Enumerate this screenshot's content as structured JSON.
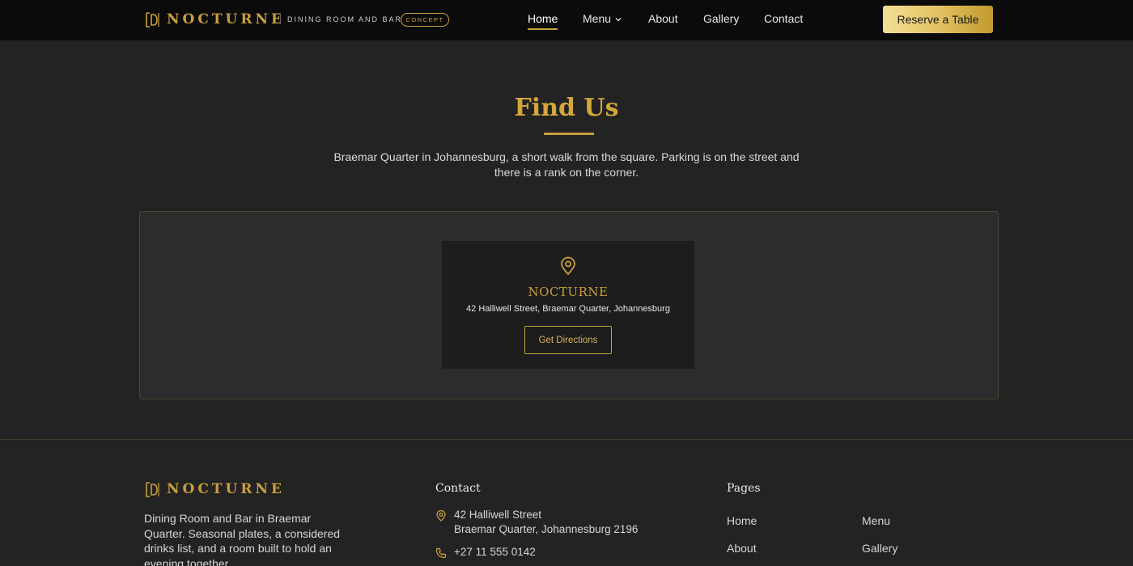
{
  "header": {
    "logo_text": "NOCTURNE",
    "tagline": "DINING ROOM AND BAR",
    "badge": "CONCEPT",
    "nav": {
      "home": "Home",
      "menu": "Menu",
      "about": "About",
      "gallery": "Gallery",
      "contact": "Contact"
    },
    "cta": "Reserve a Table"
  },
  "find_us": {
    "title": "Find Us",
    "description": "Braemar Quarter in Johannesburg, a short walk from the square. Parking is on the street and there is a rank on the corner.",
    "card": {
      "name": "NOCTURNE",
      "address": "42 Halliwell Street, Braemar Quarter, Johannesburg",
      "button": "Get Directions"
    }
  },
  "footer": {
    "logo_text": "NOCTURNE",
    "about": "Dining Room and Bar in Braemar Quarter. Seasonal plates, a considered drinks list, and a room built to hold an evening together.",
    "contact": {
      "heading": "Contact",
      "address_line1": "42 Halliwell Street",
      "address_line2": "Braemar Quarter, Johannesburg 2196",
      "phone": "+27 11 555 0142"
    },
    "pages": {
      "heading": "Pages",
      "home": "Home",
      "menu": "Menu",
      "about": "About",
      "gallery": "Gallery"
    }
  },
  "icons": {
    "logo": "logo-mark-icon",
    "nav_dropdown": "chevron-down-icon",
    "location": "map-pin-icon",
    "phone": "phone-icon"
  },
  "colors": {
    "gold": "#c9a03c",
    "background": "#232323",
    "header": "#0b0b0b",
    "panel": "#2c2c2c"
  }
}
